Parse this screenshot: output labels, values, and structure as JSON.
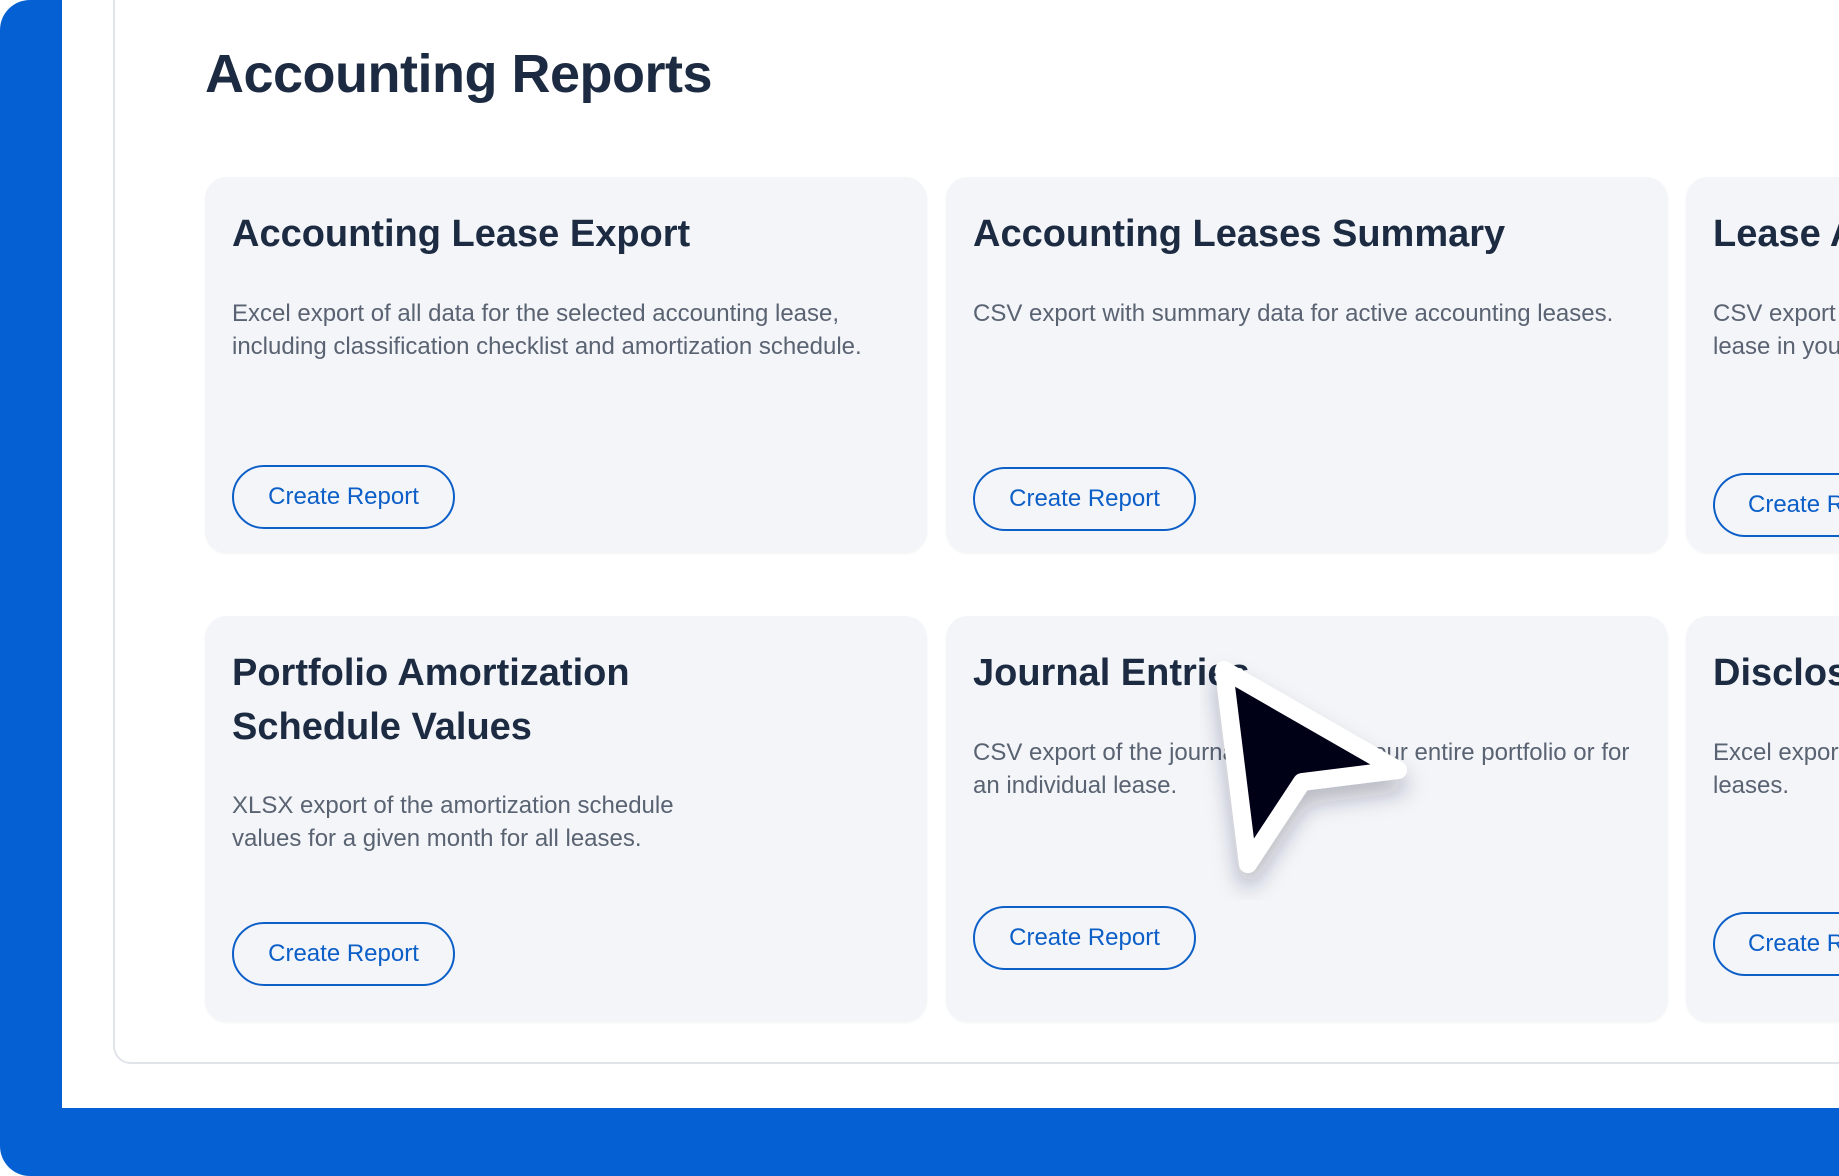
{
  "section": {
    "title": "Accounting Reports"
  },
  "cards": [
    {
      "title": "Accounting Lease Export",
      "description": "Excel export of all data for the selected accounting lease, including classification checklist and amortization schedule.",
      "button": "Create Report"
    },
    {
      "title": "Accounting Leases Summary",
      "description": "CSV export with summary data for active accounting leases.",
      "button": "Create Report"
    },
    {
      "title": "Lease Am",
      "description": "CSV export of tl lease in your po",
      "button": "Create Repor"
    },
    {
      "title": "Portfolio Amortization Schedule Values",
      "description": "XLSX export of the amortization schedule values for a given month for all leases.",
      "button": "Create Report"
    },
    {
      "title": "Journal Entries",
      "description": "CSV export of the journal entries for your entire portfolio or for an individual lease.",
      "button": "Create Report"
    },
    {
      "title": "Disclosur",
      "description": "Excel export of leases.",
      "button": "Create Repor"
    }
  ],
  "theme": {
    "frame_color": "#0560d4",
    "card_bg": "#f3f5f9",
    "title_color": "#1c2b41",
    "text_color": "#5a6372",
    "button_color": "#0d5fc8"
  },
  "cursor": {
    "icon": "mouse-pointer-icon"
  }
}
